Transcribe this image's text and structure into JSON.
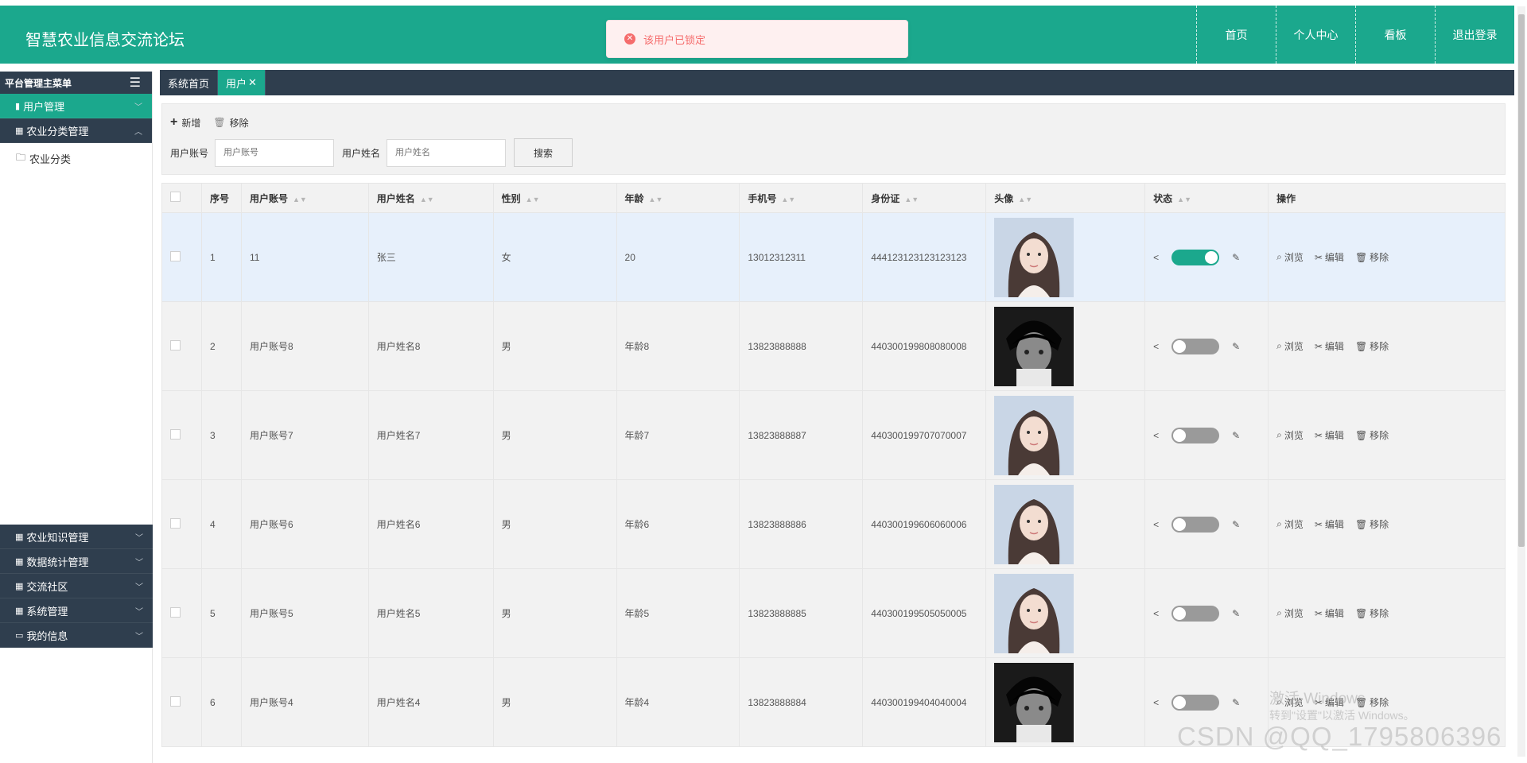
{
  "header": {
    "title": "智慧农业信息交流论坛",
    "nav": [
      "首页",
      "个人中心",
      "看板",
      "退出登录"
    ],
    "bg_color": "#1ba88d"
  },
  "toast": {
    "icon": "error-icon",
    "message": "该用户已锁定",
    "color": "#f56c6c"
  },
  "sidebar": {
    "title": "平台管理主菜单",
    "menu_icon": "hamburger-icon",
    "items": [
      {
        "label": "用户管理",
        "icon": "clipboard-icon"
      },
      {
        "label": "农业分类管理",
        "icon": "grid-icon"
      },
      {
        "label": "农业分类",
        "icon": "folder-icon"
      },
      {
        "label": "农业知识管理",
        "icon": "grid-icon"
      },
      {
        "label": "数据统计管理",
        "icon": "grid-icon"
      },
      {
        "label": "交流社区",
        "icon": "grid-icon"
      },
      {
        "label": "系统管理",
        "icon": "grid-icon"
      },
      {
        "label": "我的信息",
        "icon": "card-icon"
      }
    ]
  },
  "tabs": [
    "系统首页",
    "用户"
  ],
  "toolbar": {
    "add_label": "新增",
    "remove_label": "移除",
    "account_label": "用户账号",
    "account_placeholder": "用户账号",
    "name_label": "用户姓名",
    "name_placeholder": "用户姓名",
    "search_label": "搜索"
  },
  "table": {
    "columns": [
      "序号",
      "用户账号",
      "用户姓名",
      "性别",
      "年龄",
      "手机号",
      "身份证",
      "头像",
      "状态",
      "操作"
    ],
    "ops": [
      "浏览",
      "编辑",
      "移除"
    ],
    "rows": [
      {
        "no": "1",
        "account": "11",
        "name": "张三",
        "gender": "女",
        "age": "20",
        "phone": "13012312311",
        "id": "444123123123123123",
        "avatar": "female-portrait",
        "status_on": true
      },
      {
        "no": "2",
        "account": "用户账号8",
        "name": "用户姓名8",
        "gender": "男",
        "age": "年龄8",
        "phone": "13823888888",
        "id": "440300199808080008",
        "avatar": "anime-boy-portrait",
        "status_on": false
      },
      {
        "no": "3",
        "account": "用户账号7",
        "name": "用户姓名7",
        "gender": "男",
        "age": "年龄7",
        "phone": "13823888887",
        "id": "440300199707070007",
        "avatar": "female-portrait",
        "status_on": false
      },
      {
        "no": "4",
        "account": "用户账号6",
        "name": "用户姓名6",
        "gender": "男",
        "age": "年龄6",
        "phone": "13823888886",
        "id": "440300199606060006",
        "avatar": "female-portrait",
        "status_on": false
      },
      {
        "no": "5",
        "account": "用户账号5",
        "name": "用户姓名5",
        "gender": "男",
        "age": "年龄5",
        "phone": "13823888885",
        "id": "440300199505050005",
        "avatar": "female-portrait",
        "status_on": false
      },
      {
        "no": "6",
        "account": "用户账号4",
        "name": "用户姓名4",
        "gender": "男",
        "age": "年龄4",
        "phone": "13823888884",
        "id": "440300199404040004",
        "avatar": "anime-boy-portrait",
        "status_on": false
      }
    ]
  },
  "watermark": {
    "line1": "激活 Windows",
    "line2": "转到\"设置\"以激活 Windows。",
    "csdn": "CSDN @QQ_1795806396"
  }
}
